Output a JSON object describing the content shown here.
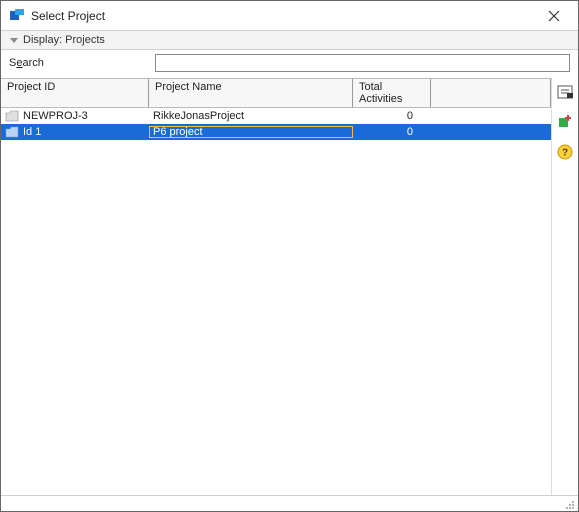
{
  "window": {
    "title": "Select Project"
  },
  "display_bar": {
    "label": "Display: Projects"
  },
  "search": {
    "label_pre": "S",
    "label_underline": "e",
    "label_post": "arch",
    "value": ""
  },
  "columns": {
    "id": "Project ID",
    "name": "Project Name",
    "activities": "Total Activities"
  },
  "rows": [
    {
      "id": "NEWPROJ-3",
      "name": "RikkeJonasProject",
      "activities": "0",
      "selected": false
    },
    {
      "id": "Id 1",
      "name": "P6 project",
      "activities": "0",
      "selected": true
    }
  ],
  "icons": {
    "close": "close-icon",
    "select": "select-icon",
    "add": "add-icon",
    "help": "help-icon"
  }
}
